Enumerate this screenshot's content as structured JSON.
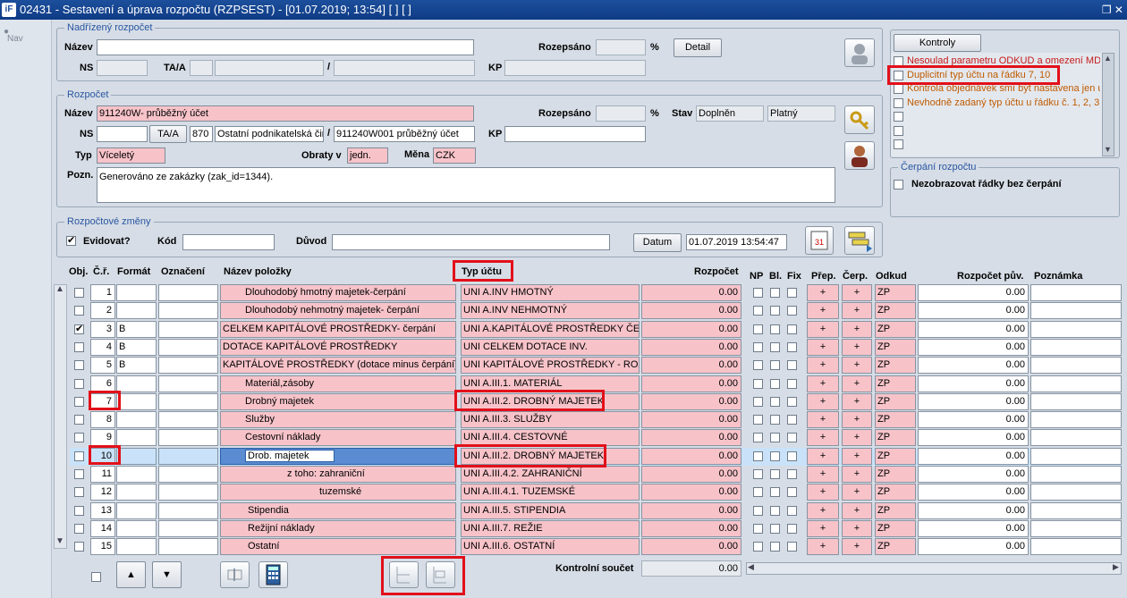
{
  "window": {
    "title": "02431 - Sestavení a úprava rozpočtu (RZPSEST) - [01.07.2019; 13:54]  [ ]  [ ]"
  },
  "nav": {
    "label": "Nav"
  },
  "nadrizeny": {
    "legend": "Nadřízený rozpočet",
    "nazev_label": "Název",
    "rozepsano_label": "Rozepsáno",
    "percent": "%",
    "detail_btn": "Detail",
    "ns_label": "NS",
    "taa_label": "TA/A",
    "slash": "/",
    "kp_label": "KP"
  },
  "rozpocet": {
    "legend": "Rozpočet",
    "nazev_label": "Název",
    "nazev_value": "911240W- průběžný účet",
    "rozepsano_label": "Rozepsáno",
    "percent": "%",
    "stav_label": "Stav",
    "stav_value": "Doplněn",
    "stav_value2": "Platný",
    "ns_label": "NS",
    "taa_btn": "TA/A",
    "taa_code": "870",
    "taa_name": "Ostatní podnikatelská čin",
    "slash": "/",
    "ucet_value": "911240W001 průběžný účet",
    "kp_label": "KP",
    "typ_label": "Typ",
    "typ_value": "Víceletý",
    "obraty_label": "Obraty v",
    "obraty_value": "jedn.",
    "mena_label": "Měna",
    "mena_value": "CZK",
    "pozn_label": "Pozn.",
    "pozn_value": "Generováno ze zakázky (zak_id=1344)."
  },
  "zmeny": {
    "legend": "Rozpočtové změny",
    "evidovat_label": "Evidovat?",
    "kod_label": "Kód",
    "duvod_label": "Důvod",
    "datum_btn": "Datum",
    "datum_value": "01.07.2019 13:54:47"
  },
  "kontroly": {
    "button": "Kontroly",
    "items": [
      "Nesoulad parametru ODKUD a omezení MD/D",
      "Duplicitní typ účtu na řádku 7, 10",
      "Kontrola objednávek smí být nastavena jen u",
      "Nevhodně zadaný typ účtu u řádku č. 1, 2, 3"
    ]
  },
  "cerpani": {
    "legend": "Čerpání rozpočtu",
    "label": "Nezobrazovat řádky bez čerpání"
  },
  "table": {
    "headers": {
      "obj": "Obj.",
      "cr": "Č.ř.",
      "format": "Formát",
      "oznaceni": "Označení",
      "nazev": "Název položky",
      "typ": "Typ účtu",
      "rozpocet": "Rozpočet",
      "np": "NP",
      "bl": "Bl.",
      "fix": "Fix",
      "prep": "Přep.",
      "cerp": "Čerp.",
      "odkud": "Odkud",
      "rozpocet_puv": "Rozpočet pův.",
      "poznamka": "Poznámka"
    },
    "rows": [
      {
        "cr": "1",
        "format": "",
        "nazev": "Dlouhodobý hmotný majetek-čerpání",
        "typ": "UNI A.INV HMOTNÝ",
        "rozpocet": "0.00",
        "odkud": "ZP",
        "puv": "0.00",
        "obj": false
      },
      {
        "cr": "2",
        "format": "",
        "nazev": "Dlouhodobý nehmotný majetek- čerpání",
        "typ": "UNI A.INV NEHMOTNÝ",
        "rozpocet": "0.00",
        "odkud": "ZP",
        "puv": "0.00",
        "obj": false
      },
      {
        "cr": "3",
        "format": "B",
        "nazev": "CELKEM KAPITÁLOVÉ PROSTŘEDKY- čerpání",
        "typ": "UNI A.KAPITÁLOVÉ PROSTŘEDKY ČERP",
        "rozpocet": "0.00",
        "odkud": "ZP",
        "puv": "0.00",
        "obj": true
      },
      {
        "cr": "4",
        "format": "B",
        "nazev": "DOTACE KAPITÁLOVÉ PROSTŘEDKY",
        "typ": "UNI CELKEM DOTACE INV.",
        "rozpocet": "0.00",
        "odkud": "ZP",
        "puv": "0.00",
        "obj": false
      },
      {
        "cr": "5",
        "format": "B",
        "nazev": "KAPITÁLOVÉ PROSTŘEDKY (dotace minus čerpání)",
        "typ": "UNI KAPITÁLOVÉ PROSTŘEDKY - ROZD",
        "rozpocet": "0.00",
        "odkud": "ZP",
        "puv": "0.00",
        "obj": false
      },
      {
        "cr": "6",
        "format": "",
        "nazev": "Materiál,zásoby",
        "typ": "UNI A.III.1. MATERIÁL",
        "rozpocet": "0.00",
        "odkud": "ZP",
        "puv": "0.00",
        "obj": false
      },
      {
        "cr": "7",
        "format": "",
        "nazev": "Drobný majetek",
        "typ": "UNI A.III.2. DROBNÝ MAJETEK",
        "rozpocet": "0.00",
        "odkud": "ZP",
        "puv": "0.00",
        "obj": false
      },
      {
        "cr": "8",
        "format": "",
        "nazev": "Služby",
        "typ": "UNI A.III.3. SLUŽBY",
        "rozpocet": "0.00",
        "odkud": "ZP",
        "puv": "0.00",
        "obj": false
      },
      {
        "cr": "9",
        "format": "",
        "nazev": "Cestovní náklady",
        "typ": "UNI A.III.4. CESTOVNÉ",
        "rozpocet": "0.00",
        "odkud": "ZP",
        "puv": "0.00",
        "obj": false
      },
      {
        "cr": "10",
        "format": "",
        "nazev": "Drob. majetek",
        "typ": "UNI A.III.2. DROBNÝ MAJETEK",
        "rozpocet": "0.00",
        "odkud": "ZP",
        "puv": "0.00",
        "obj": false
      },
      {
        "cr": "11",
        "format": "",
        "nazev": "z toho: zahraniční",
        "typ": "UNI A.III.4.2. ZAHRANIČNÍ",
        "rozpocet": "0.00",
        "odkud": "ZP",
        "puv": "0.00",
        "obj": false
      },
      {
        "cr": "12",
        "format": "",
        "nazev": "tuzemské",
        "typ": "UNI A.III.4.1. TUZEMSKÉ",
        "rozpocet": "0.00",
        "odkud": "ZP",
        "puv": "0.00",
        "obj": false
      },
      {
        "cr": "13",
        "format": "",
        "nazev": "Stipendia",
        "typ": "UNI A.III.5. STIPENDIA",
        "rozpocet": "0.00",
        "odkud": "ZP",
        "puv": "0.00",
        "obj": false
      },
      {
        "cr": "14",
        "format": "",
        "nazev": "Režijní náklady",
        "typ": "UNI A.III.7. REŽIE",
        "rozpocet": "0.00",
        "odkud": "ZP",
        "puv": "0.00",
        "obj": false
      },
      {
        "cr": "15",
        "format": "",
        "nazev": "Ostatní",
        "typ": "UNI A.III.6. OSTATNÍ",
        "rozpocet": "0.00",
        "odkud": "ZP",
        "puv": "0.00",
        "obj": false
      }
    ],
    "plus": "+"
  },
  "footer": {
    "kontrolni_label": "Kontrolní součet",
    "kontrolni_value": "0.00"
  },
  "colors": {
    "pink": "#f7c3c9",
    "highlight": "#e2101a",
    "title": "#1c4f9c"
  }
}
